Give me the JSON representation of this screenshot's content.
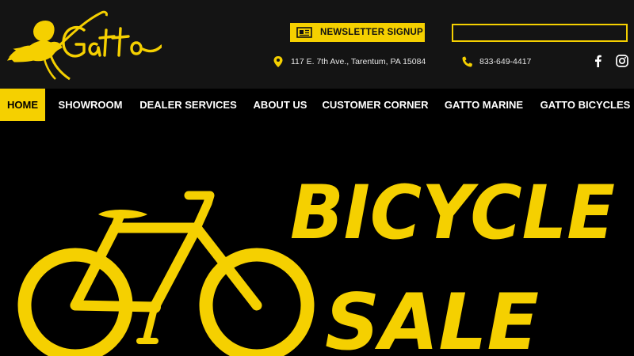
{
  "brand": {
    "logo_text": "Gatto"
  },
  "header": {
    "newsletter_label": "NEWSLETTER SIGNUP",
    "search_value": "",
    "address": "117 E. 7th Ave., Tarentum, PA 15084",
    "phone": "833-649-4417"
  },
  "icons": {
    "newsletter": "newspaper-icon",
    "address": "map-pin-icon",
    "phone": "phone-icon",
    "facebook": "facebook-icon",
    "instagram": "instagram-icon"
  },
  "nav": {
    "items": [
      {
        "label": "HOME",
        "active": true
      },
      {
        "label": "SHOWROOM"
      },
      {
        "label": "DEALER SERVICES"
      },
      {
        "label": "ABOUT US"
      },
      {
        "label": "CUSTOMER CORNER"
      },
      {
        "label": "GATTO MARINE"
      },
      {
        "label": "GATTO BICYCLES"
      }
    ]
  },
  "hero": {
    "line1": "BICYCLE",
    "line2": "SALE"
  },
  "colors": {
    "accent": "#f5d000",
    "topbar": "#141414",
    "background": "#000000"
  }
}
